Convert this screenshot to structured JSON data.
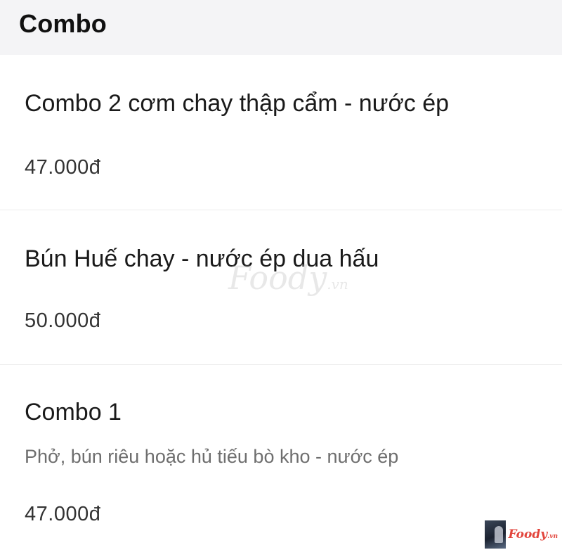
{
  "section": {
    "title": "Combo"
  },
  "items": [
    {
      "name": "Combo 2 cơm chay thập cẩm - nước ép",
      "description": "",
      "price": "47.000đ"
    },
    {
      "name": "Bún Huế chay - nước ép dua hấu",
      "description": "",
      "price": "50.000đ"
    },
    {
      "name": "Combo 1",
      "description": "Phở, bún riêu hoặc hủ tiếu bò kho - nước ép",
      "price": "47.000đ"
    }
  ],
  "watermark": {
    "main": "Foody",
    "suffix": ".vn"
  },
  "brand": {
    "main": "Foody",
    "suffix": ".vn",
    "thumb_icon": "restaurant-photo-thumbnail"
  }
}
